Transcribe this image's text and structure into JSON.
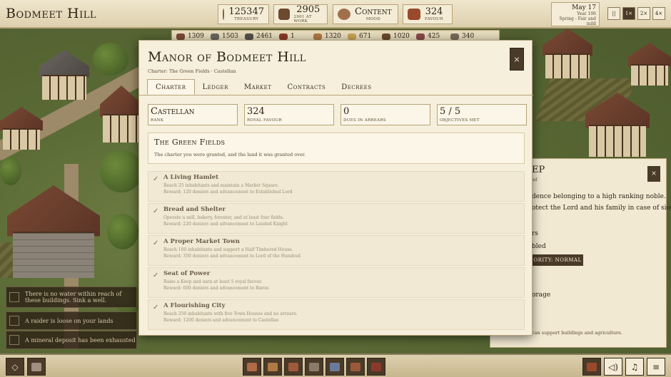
{
  "topbar": {
    "town_name": "Bodmeet Hill",
    "stats": [
      {
        "icon": "coin-bag-icon",
        "value": "125347",
        "caption": "Treasury"
      },
      {
        "icon": "workers-icon",
        "value": "2905",
        "caption": "2901 at work"
      },
      {
        "icon": "peasant-face-icon",
        "value": "Content",
        "caption": "Mood"
      },
      {
        "icon": "favour-scroll-icon",
        "value": "324",
        "caption": "Favour"
      }
    ],
    "date": {
      "day": "May 17",
      "year": "Year 106",
      "season": "Spring - Fair and mild"
    },
    "speeds": [
      "||",
      "1×",
      "2×",
      "4×"
    ],
    "active_speed_index": 1
  },
  "resources": [
    {
      "icon": "wood-icon",
      "value": "1309"
    },
    {
      "icon": "stone-icon",
      "value": "1503"
    },
    {
      "icon": "iron-icon",
      "value": "2461"
    },
    {
      "icon": "meat-icon",
      "value": "1"
    },
    {
      "icon": "bread-icon",
      "value": "1320"
    },
    {
      "icon": "wheat-icon",
      "value": "671"
    },
    {
      "icon": "ale-icon",
      "value": "1020"
    },
    {
      "icon": "cloth-icon",
      "value": "425"
    },
    {
      "icon": "tools-icon",
      "value": "340"
    }
  ],
  "notifications": [
    {
      "text": "There is no water within reach of these buildings. Sink a well."
    },
    {
      "text": "A raider is loose on your lands"
    },
    {
      "text": "A mineral deposit has been exhausted"
    }
  ],
  "building_panel": {
    "title": "EP",
    "subtitle": "nd",
    "close_label": "×",
    "line1": "dence belonging to a high ranking noble.",
    "line2": "otect the Lord and his family in case of siege.",
    "line3": "rs",
    "line4": "bled",
    "priority_label": "ORITY: NORMAL",
    "line5": "orage",
    "small_text": "can support buildings and agriculture."
  },
  "modal": {
    "title": "Manor of Bodmeet Hill",
    "subtitle": "Charter: The Green Fields · Castellan",
    "close_label": "×",
    "tabs": [
      "Charter",
      "Ledger",
      "Market",
      "Contracts",
      "Decrees"
    ],
    "active_tab": 0,
    "cards": [
      {
        "value": "Castellan",
        "label": "Rank"
      },
      {
        "value": "324",
        "label": "Royal favour"
      },
      {
        "value": "0",
        "label": "Dues in arrears"
      },
      {
        "value": "5 / 5",
        "label": "Objectives met"
      }
    ],
    "section": {
      "heading": "The Green Fields",
      "description": "The charter you were granted, and the land it was granted over."
    },
    "objectives": [
      {
        "name": "A Living Hamlet",
        "desc": "Reach 25 inhabitants and maintain a Market Square.",
        "reward": "Reward: 120 deniers and advancement to Established Lord"
      },
      {
        "name": "Bread and Shelter",
        "desc": "Operate a mill, bakery, forester, and at least four fields.",
        "reward": "Reward: 220 deniers and advancement to Landed Knight"
      },
      {
        "name": "A Proper Market Town",
        "desc": "Reach 100 inhabitants and support a Half Timbered House.",
        "reward": "Reward: 350 deniers and advancement to Lord of the Hundred"
      },
      {
        "name": "Seat of Power",
        "desc": "Raise a Keep and earn at least 5 royal favour.",
        "reward": "Reward: 600 deniers and advancement to Baron"
      },
      {
        "name": "A Flourishing City",
        "desc": "Reach 250 inhabitants with five Town Houses and no arrears.",
        "reward": "Reward: 1200 deniers and advancement to Castellan"
      }
    ],
    "check_glyph": "✓"
  },
  "bottombar": {
    "left_buttons": [
      "select-diamond-icon",
      "hammer-icon"
    ],
    "build_buttons": [
      "log-icon",
      "bread-loaf-icon",
      "fist-icon",
      "crossed-tools-icon",
      "horse-icon",
      "cart-icon",
      "banner-icon"
    ],
    "right_buttons": [
      "favour-scroll-icon",
      "speaker-icon",
      "music-note-icon",
      "menu-icon"
    ]
  },
  "colors": {
    "panel_bg": "#f6efdc",
    "border": "#b6a47a",
    "dark_button": "#4a3a28",
    "text": "#2f2418"
  }
}
